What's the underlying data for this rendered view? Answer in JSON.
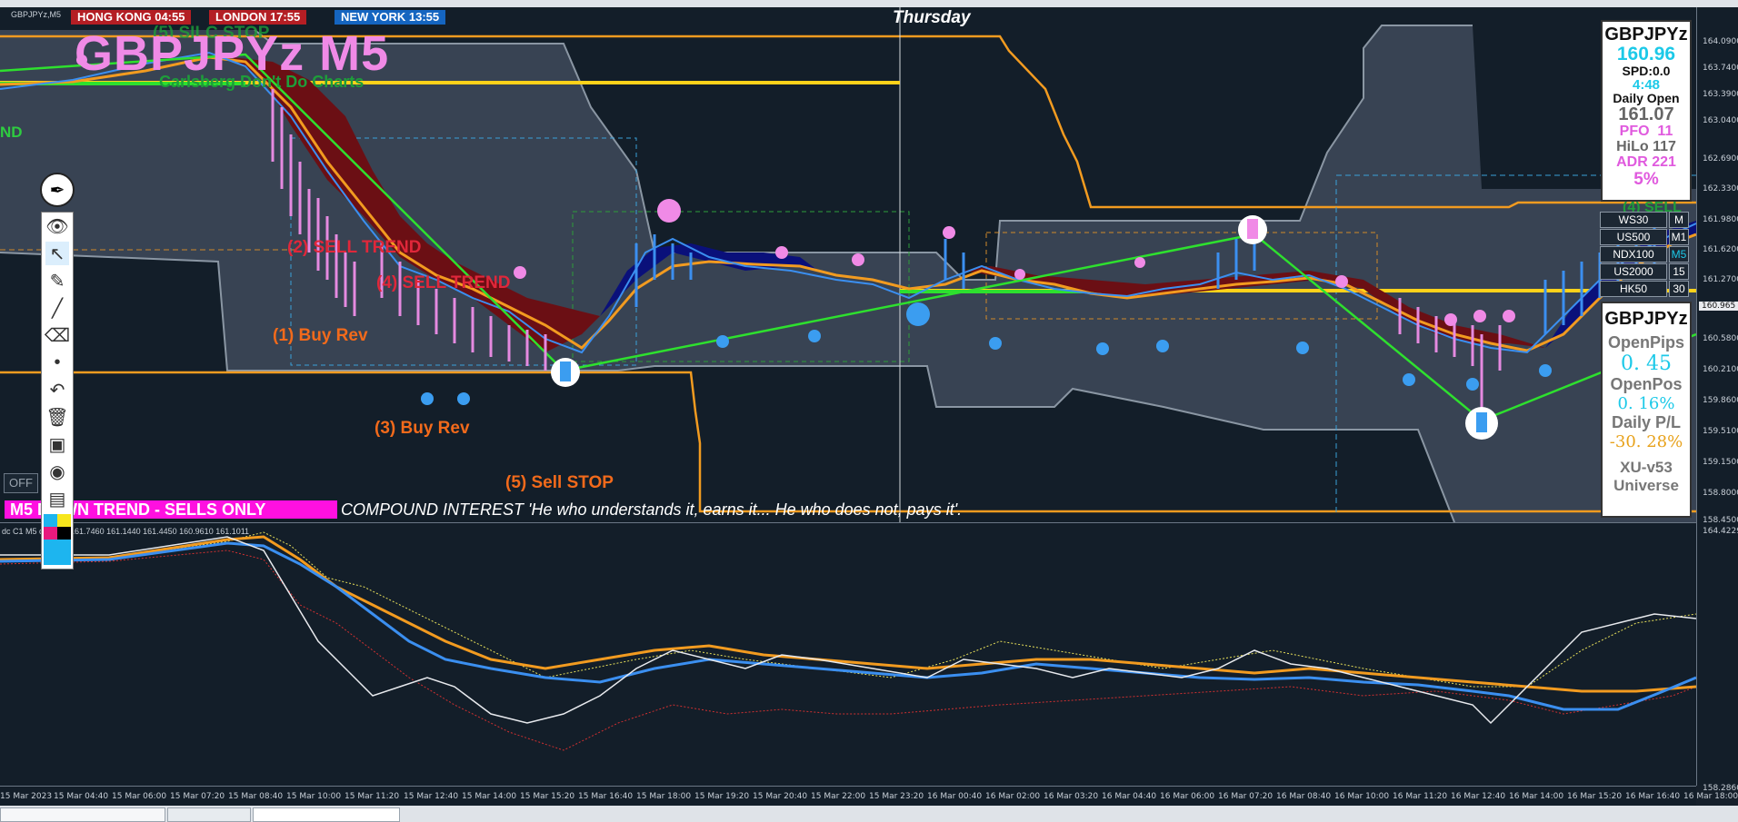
{
  "window": {
    "symbol_caption": "GBPJPYz,M5"
  },
  "sessions": [
    {
      "label": "HONG KONG 04:55",
      "color": "#b41e24"
    },
    {
      "label": "LONDON  17:55",
      "color": "#b41e24"
    },
    {
      "label": "NEW YORK 13:55",
      "color": "#1565c0"
    }
  ],
  "chart_header": {
    "day": "Thursday",
    "title": "GBPJPYz M5",
    "subtitle": "Carlsberg Don't Do Charts",
    "partial_overlay": "(5) SILC STOP",
    "left_edge_text": "ND"
  },
  "annotations": [
    {
      "id": "sell-trend-2",
      "text": "(2) SELL TREND",
      "color": "#e0273a"
    },
    {
      "id": "sell-trend-4",
      "text": "(4) SELL TREND",
      "color": "#e0273a"
    },
    {
      "id": "buy-rev-1",
      "text": "(1) Buy Rev",
      "color": "#f26a1b"
    },
    {
      "id": "buy-rev-3",
      "text": "(3) Buy Rev",
      "color": "#f26a1b"
    },
    {
      "id": "sell-stop-5",
      "text": "(5) Sell STOP",
      "color": "#f26a1b"
    },
    {
      "id": "right-edge-tag",
      "text": "(4) SELL",
      "color": "#1e9e3a"
    }
  ],
  "banner": {
    "text": "M5   DOWN TREND - SELLS ONLY",
    "off_label": "OFF"
  },
  "compound_text": "COMPOUND INTEREST  'He who understands it, earns it... He who does not, pays it'.",
  "info_panel": {
    "symbol": "GBPJPYz",
    "price": "160.96",
    "spread": "SPD:0.0",
    "timer": "4:48",
    "daily_open_label": "Daily Open",
    "daily_open_value": "161.07",
    "pfo_label": "PFO",
    "pfo_value": "11",
    "hilo_label": "HiLo",
    "hilo_value": "117",
    "adr_label": "ADR",
    "adr_value": "221",
    "pct": "5%"
  },
  "indices": [
    {
      "name": "WS30",
      "tf": "M"
    },
    {
      "name": "US500",
      "tf": "M1"
    },
    {
      "name": "NDX100",
      "tf": "M5"
    },
    {
      "name": "US2000",
      "tf": "15"
    },
    {
      "name": "HK50",
      "tf": "30"
    }
  ],
  "pl_panel": {
    "symbol": "GBPJPYz",
    "open_pips_label": "OpenPips",
    "open_pips_value": "0. 45",
    "open_pos_label": "OpenPos",
    "open_pos_value": "0. 16%",
    "daily_pl_label": "Daily P/L",
    "daily_pl_value": "-30. 28%",
    "version": "XU-v53",
    "universe": "Universe"
  },
  "price_axis": [
    "164.0900",
    "163.7400",
    "163.3900",
    "163.0400",
    "162.6900",
    "162.3300",
    "161.9800",
    "161.6200",
    "161.2700",
    "160.9600",
    "160.5800",
    "160.2100",
    "159.8600",
    "159.5100",
    "159.1500",
    "158.8000",
    "158.4500"
  ],
  "price_tag": "160.965",
  "indicator": {
    "caption": "dc C1 M5   channel 161.7460 161.1440 161.4450 160.9610 161.1011",
    "axis_top": "164.4229",
    "axis_bottom": "158.2860"
  },
  "time_axis": [
    "15 Mar 2023",
    "15 Mar 04:40",
    "15 Mar 06:00",
    "15 Mar 07:20",
    "15 Mar 08:40",
    "15 Mar 10:00",
    "15 Mar 11:20",
    "15 Mar 12:40",
    "15 Mar 14:00",
    "15 Mar 15:20",
    "15 Mar 16:40",
    "15 Mar 18:00",
    "15 Mar 19:20",
    "15 Mar 20:40",
    "15 Mar 22:00",
    "15 Mar 23:20",
    "16 Mar 00:40",
    "16 Mar 02:00",
    "16 Mar 03:20",
    "16 Mar 04:40",
    "16 Mar 06:00",
    "16 Mar 07:20",
    "16 Mar 08:40",
    "16 Mar 10:00",
    "16 Mar 11:20",
    "16 Mar 12:40",
    "16 Mar 14:00",
    "16 Mar 15:20",
    "16 Mar 16:40",
    "16 Mar 18:00"
  ],
  "colors": {
    "bg": "#131e29",
    "ribbon_bear": "#6b0f14",
    "ribbon_bull": "#0a107a",
    "channel": "#f29b20",
    "support": "#ffd21a",
    "trend": "#2ee02e"
  }
}
